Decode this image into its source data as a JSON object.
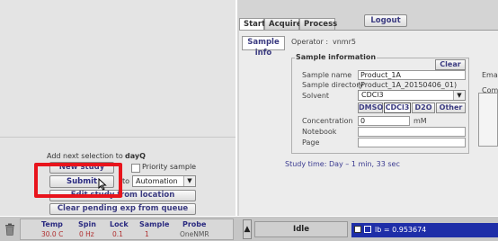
{
  "left": {
    "add_next_label": "Add next selection to",
    "add_next_target": "dayQ",
    "new_study_label": "New study",
    "priority_label": "Priority sample",
    "submit_label": "Submit",
    "to_label": "to",
    "automation_value": "Automation",
    "edit_study_label": "Edit study from location",
    "clear_pending_label": "Clear pending exp from queue"
  },
  "tabs": [
    {
      "label": "Start"
    },
    {
      "label": "Acquire"
    },
    {
      "label": "Process"
    }
  ],
  "logout_label": "Logout",
  "side_tab_label": "Sample info",
  "operator": {
    "label": "Operator :",
    "value": "vnmr5"
  },
  "sample_info": {
    "title": "Sample information",
    "clear_label": "Clear",
    "email_label": "Email",
    "comment_label": "Comm",
    "sample_name_label": "Sample name",
    "sample_name_value": "Product_1A",
    "sample_dir_label": "Sample directory",
    "sample_dir_value": "(Product_1A_20150406_01)",
    "solvent_label": "Solvent",
    "solvent_value": "CDCl3",
    "solvent_buttons": [
      "DMSO",
      "CDCl3",
      "D2O",
      "Other"
    ],
    "concentration_label": "Concentration",
    "concentration_value": "0",
    "concentration_unit": "mM",
    "notebook_label": "Notebook",
    "page_label": "Page"
  },
  "study_time": "Study time: Day – 1 min, 33 sec",
  "status_bar": {
    "headers": [
      "Temp",
      "Spin",
      "Lock",
      "Sample",
      "Probe"
    ],
    "values": [
      "30.0 C",
      "0 Hz",
      "0.1",
      "1",
      "OneNMR"
    ],
    "state": "Idle",
    "lock_readout": "lb = 0.953674"
  },
  "colors": {
    "accent": "#2a2a80",
    "highlight": "#e8141c",
    "status_blue": "#1e2ea8"
  }
}
